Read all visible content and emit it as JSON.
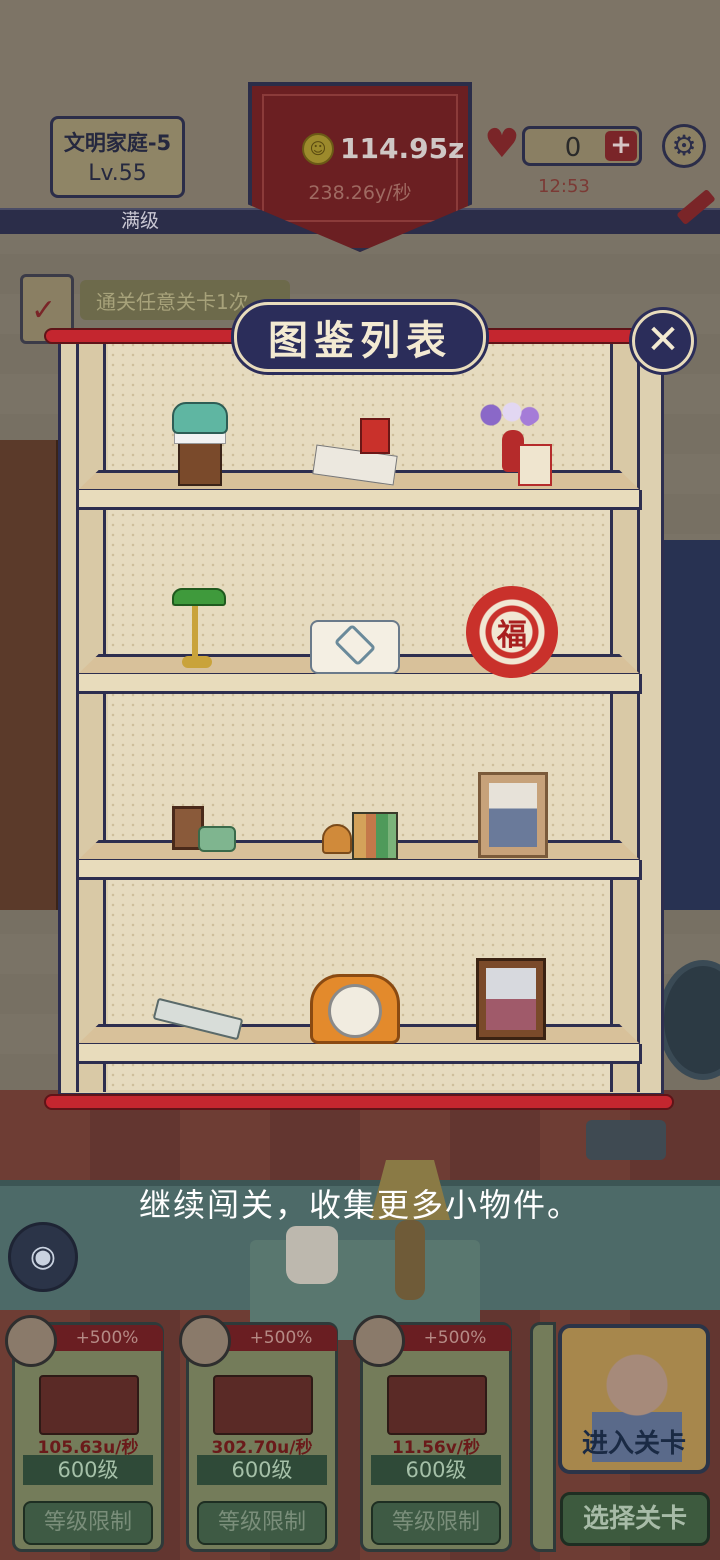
{
  "hud": {
    "family_name": "文明家庭-5",
    "family_level": "Lv.55",
    "max_level_label": "满级",
    "coins": "114.95z",
    "coin_rate": "238.26y/秒",
    "hearts": "0",
    "timer": "12:53",
    "plus_label": "+",
    "settings_icon": "gear-icon",
    "coin_icon": "smiley-coin-icon",
    "heart_icon": "heart-icon"
  },
  "task": {
    "label": "通关任意关卡1次"
  },
  "modal": {
    "title": "图鉴列表",
    "close_label": "✕",
    "collectibles_per_shelf": [
      [
        "rotary-phone-on-stool",
        "newspaper-and-red-box",
        "vase-with-flowers-and-gift-box"
      ],
      [
        "green-desk-lamp",
        "tissue-box",
        "fu-paper-cut"
      ],
      [
        "small-photo-and-tea-cups",
        "clock-and-books",
        "family-photo-frame"
      ],
      [
        "harmonica",
        "orange-mantel-clock",
        "couple-photo-frame"
      ]
    ],
    "fu_character": "福"
  },
  "prompt": "继续闯关，收集更多小物件。",
  "bottom": {
    "camera_icon": "camera-icon",
    "cards": [
      {
        "bonus": "+500%",
        "rate": "105.63u/秒",
        "level": "600级",
        "limit": "等级限制"
      },
      {
        "bonus": "+500%",
        "rate": "302.70u/秒",
        "level": "600级",
        "limit": "等级限制"
      },
      {
        "bonus": "+500%",
        "rate": "11.56v/秒",
        "level": "600级",
        "limit": "等级限制"
      }
    ],
    "enter_label": "进入关卡",
    "select_label": "选择关卡"
  },
  "colors": {
    "accent_red": "#c4262f",
    "navy": "#2b2d5a",
    "shelf": "#e6dbbf"
  }
}
